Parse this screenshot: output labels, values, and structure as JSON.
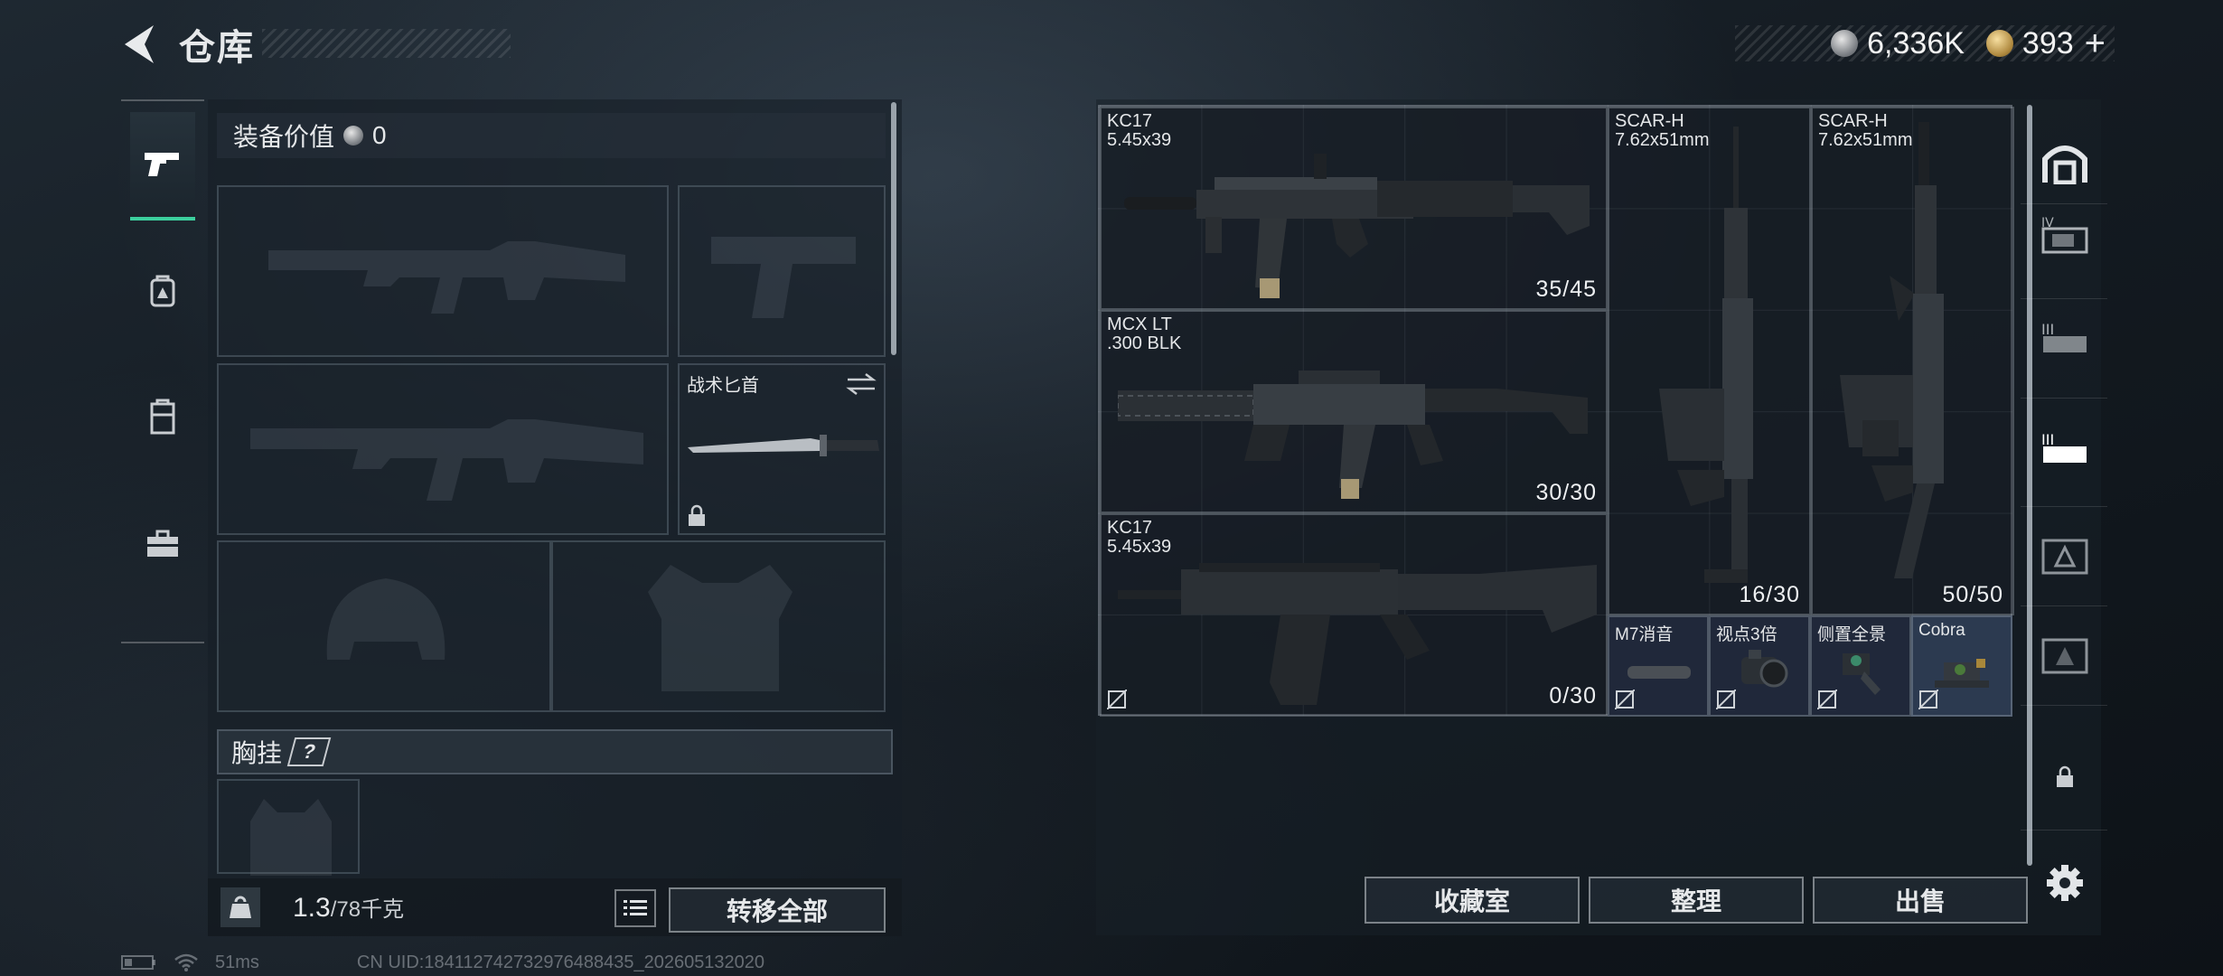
{
  "header": {
    "title": "仓库"
  },
  "currency": {
    "silver": "6,336K",
    "gold": "393",
    "plus": "+"
  },
  "left_rail": {
    "items": [
      "pistol-icon",
      "backpack-icon",
      "locker-icon",
      "toolbox-icon"
    ]
  },
  "loadout": {
    "equip_value_label": "装备价值",
    "equip_value": "0",
    "knife_label": "战术匕首",
    "chest_rig_label": "胸挂",
    "help": "?",
    "weight_current": "1.3",
    "weight_max": "/78千克",
    "transfer_all": "转移全部"
  },
  "storage": {
    "items": [
      {
        "name": "KC17",
        "caliber": "5.45x39",
        "ammo": "35/45"
      },
      {
        "name": "MCX LT",
        "caliber": ".300 BLK",
        "ammo": "30/30"
      },
      {
        "name": "KC17",
        "caliber": "5.45x39",
        "ammo": "0/30"
      },
      {
        "name": "SCAR-H",
        "caliber": "7.62x51mm",
        "ammo": "16/30"
      },
      {
        "name": "SCAR-H",
        "caliber": "7.62x51mm",
        "ammo": "50/50"
      }
    ],
    "attachments": [
      "M7消音",
      "视点3倍",
      "侧置全景",
      "Cobra"
    ],
    "buttons": {
      "collection": "收藏室",
      "organize": "整理",
      "sell": "出售"
    }
  },
  "right_tabs": [
    "safe-box-icon",
    "storage-tab-iv-icon",
    "storage-tab-iii-icon",
    "storage-tab-ii-icon",
    "storage-tab-alpha-icon",
    "storage-tab-beta-icon",
    "locked-tab-icon",
    "settings-icon"
  ],
  "status": {
    "ping": "51ms",
    "uid": "CN UID:184112742732976488435_202605132020"
  },
  "colors": {
    "accent": "#3ccf9e",
    "attachment_bg": "#20283a"
  }
}
